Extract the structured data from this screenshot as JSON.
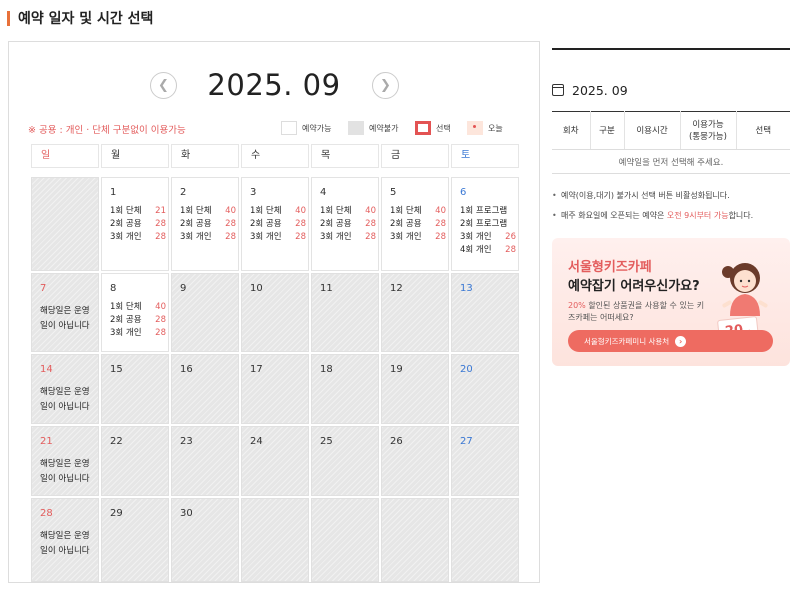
{
  "page": {
    "title": "예약 일자 및 시간 선택"
  },
  "calendar": {
    "month_label": "2025. 09",
    "prev_icon": "chevron-left-icon",
    "next_icon": "chevron-right-icon",
    "notice": "※ 공용 : 개인 · 단체 구분없이 이용가능",
    "legend": {
      "available": "예약가능",
      "unavailable": "예약불가",
      "selected": "선택",
      "today": "오늘"
    },
    "weekdays": [
      "일",
      "월",
      "화",
      "수",
      "목",
      "금",
      "토"
    ],
    "closed_text": "해당일은 운영일이 아닙니다",
    "cells": [
      {
        "day": "",
        "state": "disabled"
      },
      {
        "day": "1",
        "state": "available",
        "sessions": [
          {
            "label": "1회 단체",
            "count": "21"
          },
          {
            "label": "2회 공용",
            "count": "28"
          },
          {
            "label": "3회 개인",
            "count": "28"
          }
        ]
      },
      {
        "day": "2",
        "state": "available",
        "sessions": [
          {
            "label": "1회 단체",
            "count": "40"
          },
          {
            "label": "2회 공용",
            "count": "28"
          },
          {
            "label": "3회 개인",
            "count": "28"
          }
        ]
      },
      {
        "day": "3",
        "state": "available",
        "sessions": [
          {
            "label": "1회 단체",
            "count": "40"
          },
          {
            "label": "2회 공용",
            "count": "28"
          },
          {
            "label": "3회 개인",
            "count": "28"
          }
        ]
      },
      {
        "day": "4",
        "state": "available",
        "sessions": [
          {
            "label": "1회 단체",
            "count": "40"
          },
          {
            "label": "2회 공용",
            "count": "28"
          },
          {
            "label": "3회 개인",
            "count": "28"
          }
        ]
      },
      {
        "day": "5",
        "state": "available",
        "sessions": [
          {
            "label": "1회 단체",
            "count": "40"
          },
          {
            "label": "2회 공용",
            "count": "28"
          },
          {
            "label": "3회 개인",
            "count": "28"
          }
        ]
      },
      {
        "day": "6",
        "state": "available",
        "sessions": [
          {
            "label": "1회 프로그램",
            "count": ""
          },
          {
            "label": "2회 프로그램",
            "count": ""
          },
          {
            "label": "3회 개인",
            "count": "26"
          },
          {
            "label": "4회 개인",
            "count": "28"
          }
        ]
      },
      {
        "day": "7",
        "state": "closed"
      },
      {
        "day": "8",
        "state": "available",
        "sessions": [
          {
            "label": "1회 단체",
            "count": "40"
          },
          {
            "label": "2회 공용",
            "count": "28"
          },
          {
            "label": "3회 개인",
            "count": "28"
          }
        ]
      },
      {
        "day": "9",
        "state": "disabled"
      },
      {
        "day": "10",
        "state": "disabled"
      },
      {
        "day": "11",
        "state": "disabled"
      },
      {
        "day": "12",
        "state": "disabled"
      },
      {
        "day": "13",
        "state": "disabled"
      },
      {
        "day": "14",
        "state": "closed"
      },
      {
        "day": "15",
        "state": "disabled"
      },
      {
        "day": "16",
        "state": "disabled"
      },
      {
        "day": "17",
        "state": "disabled"
      },
      {
        "day": "18",
        "state": "disabled"
      },
      {
        "day": "19",
        "state": "disabled"
      },
      {
        "day": "20",
        "state": "disabled"
      },
      {
        "day": "21",
        "state": "closed"
      },
      {
        "day": "22",
        "state": "disabled"
      },
      {
        "day": "23",
        "state": "disabled"
      },
      {
        "day": "24",
        "state": "disabled"
      },
      {
        "day": "25",
        "state": "disabled"
      },
      {
        "day": "26",
        "state": "disabled"
      },
      {
        "day": "27",
        "state": "disabled"
      },
      {
        "day": "28",
        "state": "closed"
      },
      {
        "day": "29",
        "state": "disabled"
      },
      {
        "day": "30",
        "state": "disabled"
      },
      {
        "day": "",
        "state": "disabled"
      },
      {
        "day": "",
        "state": "disabled"
      },
      {
        "day": "",
        "state": "disabled"
      },
      {
        "day": "",
        "state": "disabled"
      }
    ]
  },
  "side": {
    "date_label": "2025. 09",
    "date_icon": "calendar-icon",
    "table_headers": [
      "회차",
      "구분",
      "이용시간",
      "이용가능\n(통뭉가능)",
      "선택"
    ],
    "empty_message": "예약일을 먼저 선택해 주세요.",
    "notes": [
      {
        "text": "예약(이용,대기) 불가시 선택 버튼 비활성화됩니다."
      },
      {
        "pre": "매주 화요일에 오픈되는 예약은 ",
        "highlight": "오전 9시부터 가능",
        "post": "합니다."
      }
    ],
    "promo": {
      "brand": "서울형키즈카페",
      "headline": "예약잡기 어려우신가요?",
      "desc_highlight": "20%",
      "desc_rest": " 할인된 상품권을 사용할 수 있는 키즈카페는 어떠세요?",
      "button_label": "서울형키즈카페미니 사용처",
      "badge_value": "20",
      "badge_unit": "%"
    }
  },
  "colors": {
    "accent": "#e35d5d",
    "saturday": "#3a78d4",
    "title_bar": "#e8713a",
    "disabled_bg": "#e6e6e6"
  }
}
